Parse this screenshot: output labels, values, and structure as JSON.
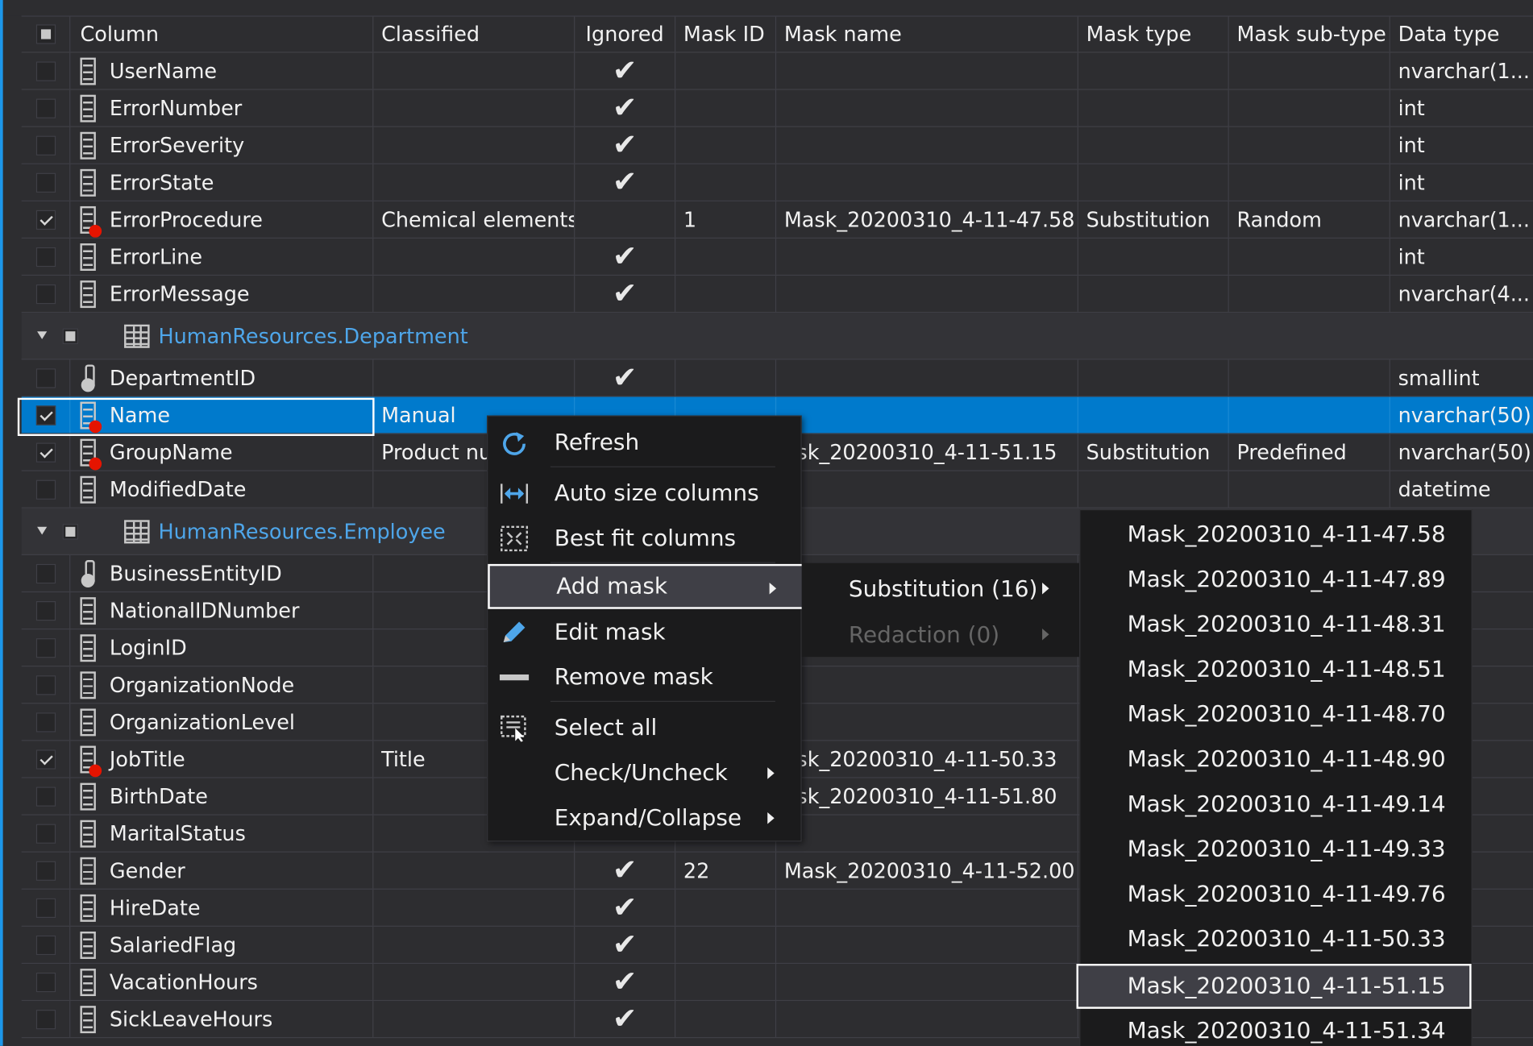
{
  "header": {
    "column": "Column",
    "classified": "Classified",
    "ignored": "Ignored",
    "mask_id": "Mask ID",
    "mask_name": "Mask name",
    "mask_type": "Mask type",
    "mask_subtype": "Mask sub-type",
    "data_type": "Data type"
  },
  "rows_a": [
    {
      "name": "UserName",
      "classified": "",
      "ignored": "✔",
      "mask_id": "",
      "mask_name": "",
      "mask_type": "",
      "mask_subtype": "",
      "data_type": "nvarchar(1..."
    },
    {
      "name": "ErrorNumber",
      "classified": "",
      "ignored": "✔",
      "mask_id": "",
      "mask_name": "",
      "mask_type": "",
      "mask_subtype": "",
      "data_type": "int"
    },
    {
      "name": "ErrorSeverity",
      "classified": "",
      "ignored": "✔",
      "mask_id": "",
      "mask_name": "",
      "mask_type": "",
      "mask_subtype": "",
      "data_type": "int"
    },
    {
      "name": "ErrorState",
      "classified": "",
      "ignored": "✔",
      "mask_id": "",
      "mask_name": "",
      "mask_type": "",
      "mask_subtype": "",
      "data_type": "int"
    },
    {
      "name": "ErrorProcedure",
      "classified": "Chemical elements",
      "ignored": "",
      "mask_id": "1",
      "mask_name": "Mask_20200310_4-11-47.58",
      "mask_type": "Substitution",
      "mask_subtype": "Random",
      "data_type": "nvarchar(1..."
    },
    {
      "name": "ErrorLine",
      "classified": "",
      "ignored": "✔",
      "mask_id": "",
      "mask_name": "",
      "mask_type": "",
      "mask_subtype": "",
      "data_type": "int"
    },
    {
      "name": "ErrorMessage",
      "classified": "",
      "ignored": "✔",
      "mask_id": "",
      "mask_name": "",
      "mask_type": "",
      "mask_subtype": "",
      "data_type": "nvarchar(4..."
    }
  ],
  "group1": {
    "name": "HumanResources.Department"
  },
  "rows_b": [
    {
      "name": "DepartmentID",
      "classified": "",
      "ignored": "✔",
      "mask_id": "",
      "mask_name": "",
      "mask_type": "",
      "mask_subtype": "",
      "data_type": "smallint"
    },
    {
      "name": "Name",
      "classified": "Manual",
      "ignored": "",
      "mask_id": "",
      "mask_name": "",
      "mask_type": "",
      "mask_subtype": "",
      "data_type": "nvarchar(50)"
    },
    {
      "name": "GroupName",
      "classified": "Product nur",
      "ignored": "",
      "mask_id": "",
      "mask_name": "ask_20200310_4-11-51.15",
      "mask_type": "Substitution",
      "mask_subtype": "Predefined",
      "data_type": "nvarchar(50)"
    },
    {
      "name": "ModifiedDate",
      "classified": "",
      "ignored": "",
      "mask_id": "",
      "mask_name": "",
      "mask_type": "",
      "mask_subtype": "",
      "data_type": "datetime"
    }
  ],
  "group2": {
    "name": "HumanResources.Employee"
  },
  "rows_c": [
    {
      "name": "BusinessEntityID",
      "classified": "",
      "ignored": "",
      "mask_id": "",
      "mask_name": "",
      "mask_type": "",
      "mask_subtype": "",
      "data_type": ""
    },
    {
      "name": "NationalIDNumber",
      "classified": "",
      "ignored": "",
      "mask_id": "",
      "mask_name": "",
      "mask_type": "",
      "mask_subtype": "",
      "data_type": "r(15)"
    },
    {
      "name": "LoginID",
      "classified": "",
      "ignored": "",
      "mask_id": "",
      "mask_name": "",
      "mask_type": "",
      "mask_subtype": "",
      "data_type": "r(2..."
    },
    {
      "name": "OrganizationNode",
      "classified": "",
      "ignored": "",
      "mask_id": "",
      "mask_name": "",
      "mask_type": "",
      "mask_subtype": "",
      "data_type": "yid"
    },
    {
      "name": "OrganizationLevel",
      "classified": "",
      "ignored": "",
      "mask_id": "",
      "mask_name": "",
      "mask_type": "",
      "mask_subtype": "",
      "data_type": "ed, ..."
    },
    {
      "name": "JobTitle",
      "classified": "Title",
      "ignored": "",
      "mask_id": "",
      "mask_name": "ask_20200310_4-11-50.33",
      "mask_type": "",
      "mask_subtype": "",
      "data_type": "r(50)"
    },
    {
      "name": "BirthDate",
      "classified": "",
      "ignored": "",
      "mask_id": "",
      "mask_name": "ask_20200310_4-11-51.80",
      "mask_type": "",
      "mask_subtype": "",
      "data_type": ""
    },
    {
      "name": "MaritalStatus",
      "classified": "",
      "ignored": "",
      "mask_id": "",
      "mask_name": "",
      "mask_type": "",
      "mask_subtype": "",
      "data_type": ")"
    },
    {
      "name": "Gender",
      "classified": "",
      "ignored": "✔",
      "mask_id": "22",
      "mask_name": "Mask_20200310_4-11-52.00",
      "mask_type": "",
      "mask_subtype": "",
      "data_type": ")"
    },
    {
      "name": "HireDate",
      "classified": "",
      "ignored": "✔",
      "mask_id": "",
      "mask_name": "",
      "mask_type": "",
      "mask_subtype": "",
      "data_type": ""
    },
    {
      "name": "SalariedFlag",
      "classified": "",
      "ignored": "✔",
      "mask_id": "",
      "mask_name": "",
      "mask_type": "",
      "mask_subtype": "",
      "data_type": ""
    },
    {
      "name": "VacationHours",
      "classified": "",
      "ignored": "✔",
      "mask_id": "",
      "mask_name": "",
      "mask_type": "",
      "mask_subtype": "",
      "data_type": ""
    },
    {
      "name": "SickLeaveHours",
      "classified": "",
      "ignored": "✔",
      "mask_id": "",
      "mask_name": "",
      "mask_type": "",
      "mask_subtype": "",
      "data_type": ""
    }
  ],
  "menu": {
    "refresh": "Refresh",
    "auto_size": "Auto size columns",
    "best_fit": "Best fit columns",
    "add_mask": "Add mask",
    "edit_mask": "Edit mask",
    "remove_mask": "Remove mask",
    "select_all": "Select all",
    "check_uncheck": "Check/Uncheck",
    "expand_collapse": "Expand/Collapse"
  },
  "submenu": {
    "substitution": "Substitution (16)",
    "redaction": "Redaction (0)"
  },
  "masks": [
    "Mask_20200310_4-11-47.58",
    "Mask_20200310_4-11-47.89",
    "Mask_20200310_4-11-48.31",
    "Mask_20200310_4-11-48.51",
    "Mask_20200310_4-11-48.70",
    "Mask_20200310_4-11-48.90",
    "Mask_20200310_4-11-49.14",
    "Mask_20200310_4-11-49.33",
    "Mask_20200310_4-11-49.76",
    "Mask_20200310_4-11-50.33",
    "Mask_20200310_4-11-51.15",
    "Mask_20200310_4-11-51.34"
  ],
  "colors": {
    "accent": "#007acc",
    "link": "#4ea6ea",
    "background": "#2d2d30",
    "menu": "#1b1b1c",
    "pii_dot": "#e51400"
  }
}
